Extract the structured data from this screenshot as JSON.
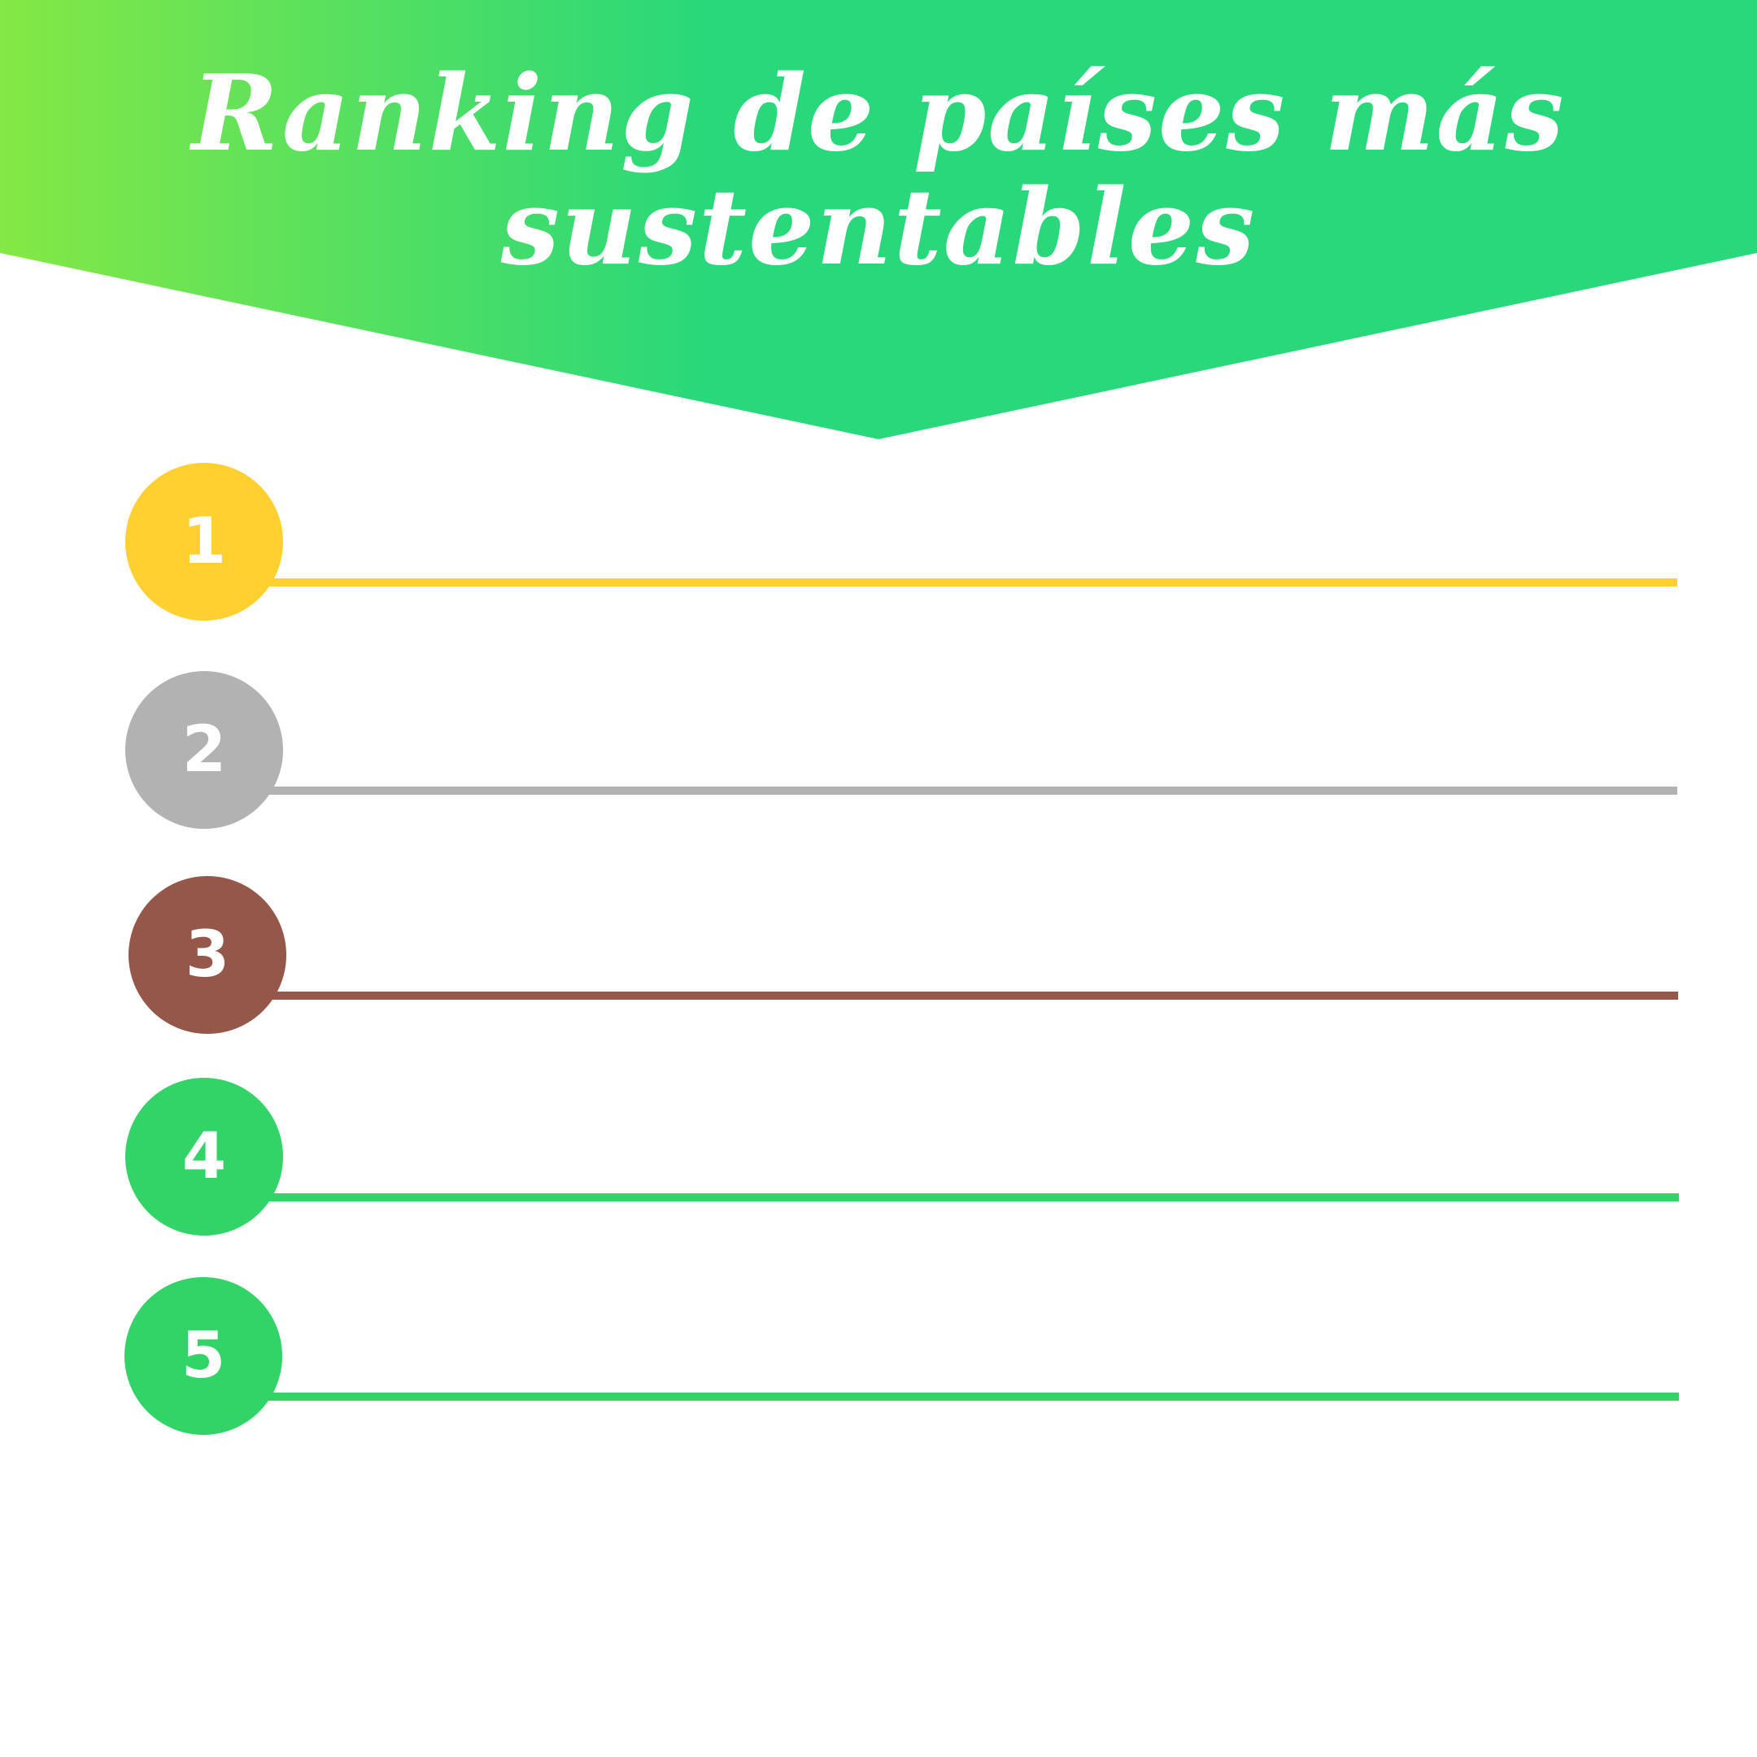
{
  "header": {
    "title": "Ranking de países más sustentables",
    "gradient_start": "#84E845",
    "gradient_end": "#29D87A"
  },
  "ranking": [
    {
      "number": "1",
      "color": "#FFD02F"
    },
    {
      "number": "2",
      "color": "#B2B2B2"
    },
    {
      "number": "3",
      "color": "#95574A"
    },
    {
      "number": "4",
      "color": "#33D467"
    },
    {
      "number": "5",
      "color": "#33D467"
    }
  ]
}
